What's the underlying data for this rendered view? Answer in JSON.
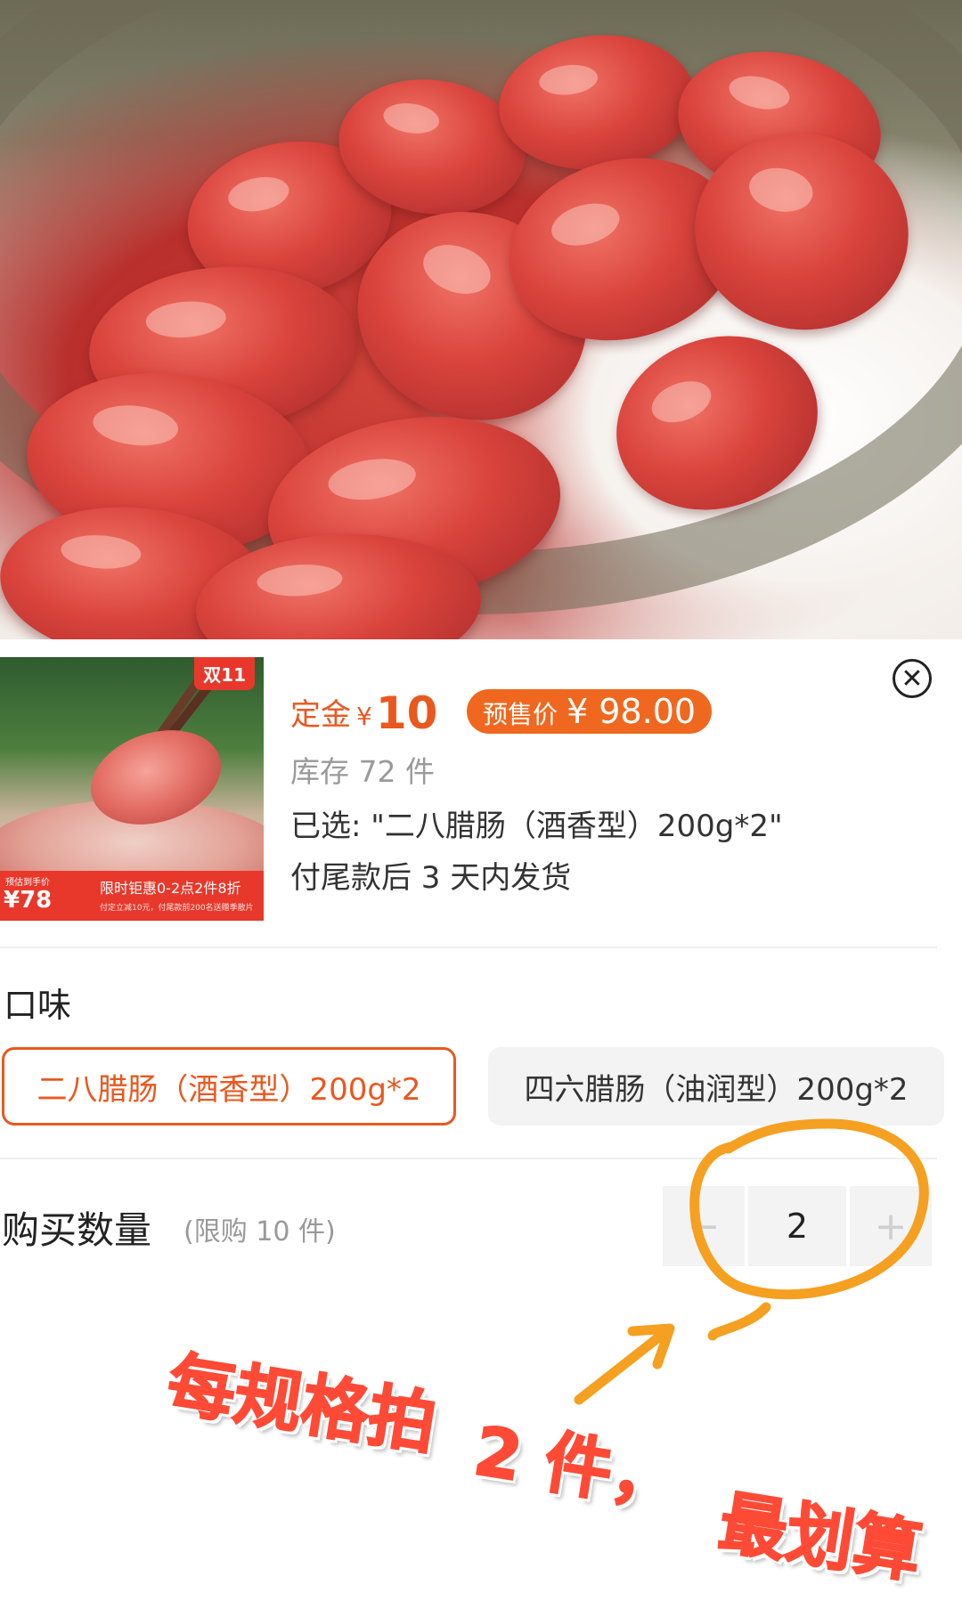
{
  "product": {
    "thumbnail": {
      "badge": "双11",
      "price_label": "预估到手价",
      "price_value": "¥78",
      "promo_text": "限时钜惠0-2点2件8折",
      "fine_print": "付定立减10元，付尾款前200名送赠季散片"
    },
    "deposit_label": "定金",
    "deposit_currency": "¥",
    "deposit_amount": "10",
    "presale_label": "预售价",
    "presale_price": "¥ 98.00",
    "stock": "库存 72 件",
    "selected": "已选: \"二八腊肠（酒香型）200g*2\"",
    "shipping": "付尾款后 3 天内发货"
  },
  "flavor": {
    "title": "口味",
    "options": [
      {
        "label": "二八腊肠（酒香型）200g*2",
        "selected": true
      },
      {
        "label": "四六腊肠（油润型）200g*2",
        "selected": false
      }
    ]
  },
  "quantity": {
    "title": "购买数量",
    "limit": "(限购 10 件)",
    "minus_symbol": "−",
    "value": "2",
    "plus_symbol": "+"
  },
  "annotation": {
    "text_part1": "每规格拍",
    "text_part2": "2 件，",
    "text_part3": "最划算",
    "color": "#f5a021"
  },
  "icons": {
    "close": "close-icon"
  }
}
